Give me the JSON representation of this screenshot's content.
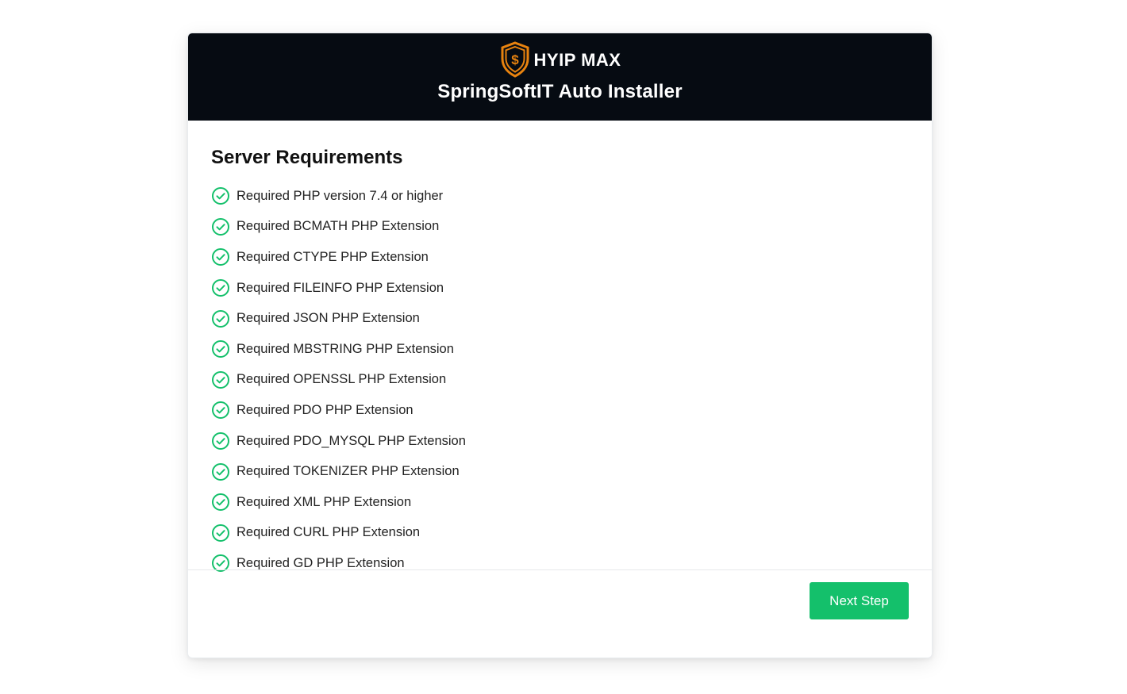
{
  "header": {
    "brand_name": "HYIP MAX",
    "logo_icon": "shield-dollar-icon",
    "title": "SpringSoftIT Auto Installer"
  },
  "main": {
    "section_title": "Server Requirements",
    "status_icon": "check-circle-icon",
    "requirements": [
      "Required PHP version 7.4 or higher",
      "Required BCMATH PHP Extension",
      "Required CTYPE PHP Extension",
      "Required FILEINFO PHP Extension",
      "Required JSON PHP Extension",
      "Required MBSTRING PHP Extension",
      "Required OPENSSL PHP Extension",
      "Required PDO PHP Extension",
      "Required PDO_MYSQL PHP Extension",
      "Required TOKENIZER PHP Extension",
      "Required XML PHP Extension",
      "Required CURL PHP Extension",
      "Required GD PHP Extension"
    ]
  },
  "footer": {
    "next_label": "Next Step"
  },
  "colors": {
    "header_bg": "#060b12",
    "accent_green": "#14c06b",
    "logo_orange": "#e8830f"
  }
}
